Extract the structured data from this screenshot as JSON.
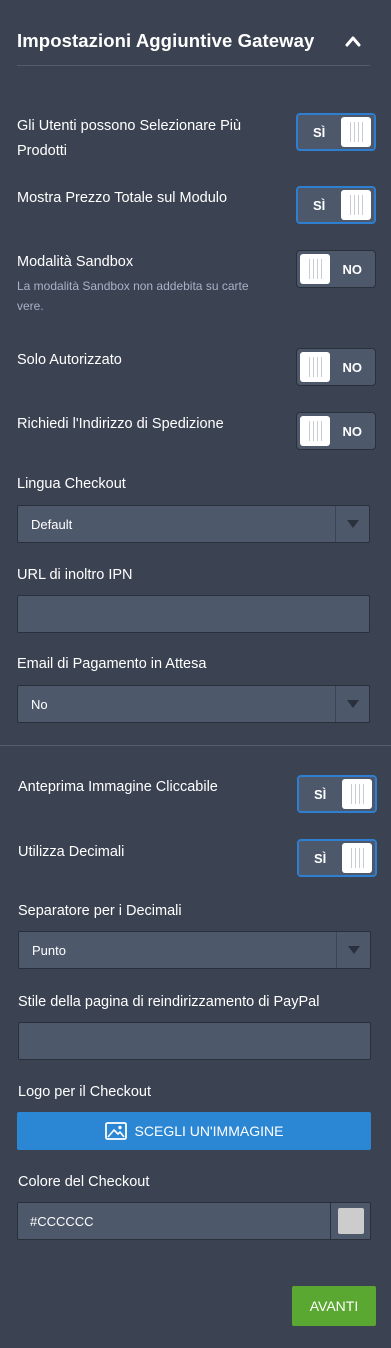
{
  "header": {
    "title": "Impostazioni Aggiuntive Gateway",
    "collapse_icon": "chevron-up-icon"
  },
  "settings": {
    "multi_product": {
      "label": "Gli Utenti possono Selezionare Più Prodotti",
      "toggle": "SÌ",
      "state": "on"
    },
    "total_price": {
      "label": "Mostra Prezzo Totale sul Modulo",
      "toggle": "SÌ",
      "state": "on"
    },
    "sandbox": {
      "label": "Modalità Sandbox",
      "sublabel": "La modalità Sandbox non addebita su carte vere.",
      "toggle": "NO",
      "state": "off"
    },
    "authorized_only": {
      "label": "Solo Autorizzato",
      "toggle": "NO",
      "state": "off"
    },
    "shipping_address": {
      "label": "Richiedi l'Indirizzo di Spedizione",
      "toggle": "NO",
      "state": "off"
    },
    "checkout_language": {
      "label": "Lingua Checkout",
      "value": "Default"
    },
    "ipn_url": {
      "label": "URL di inoltro IPN",
      "value": ""
    },
    "pending_email": {
      "label": "Email di Pagamento in Attesa",
      "value": "No"
    },
    "clickable_preview": {
      "label": "Anteprima Immagine Cliccabile",
      "toggle": "SÌ",
      "state": "on"
    },
    "use_decimals": {
      "label": "Utilizza Decimali",
      "toggle": "SÌ",
      "state": "on"
    },
    "decimal_separator": {
      "label": "Separatore per i Decimali",
      "value": "Punto"
    },
    "paypal_page_style": {
      "label": "Stile della pagina di reindirizzamento di PayPal",
      "value": ""
    },
    "checkout_logo": {
      "label": "Logo per il Checkout",
      "button": "SCEGLI UN'IMMAGINE",
      "icon": "image-icon"
    },
    "checkout_color": {
      "label": "Colore del Checkout",
      "value": "#CCCCCC",
      "swatch_color": "#cccccc"
    }
  },
  "footer": {
    "next_label": "AVANTI"
  },
  "colors": {
    "accent": "#2b86d4",
    "next": "#5aa831",
    "panel": "#3b4251",
    "field": "#4d586b"
  }
}
